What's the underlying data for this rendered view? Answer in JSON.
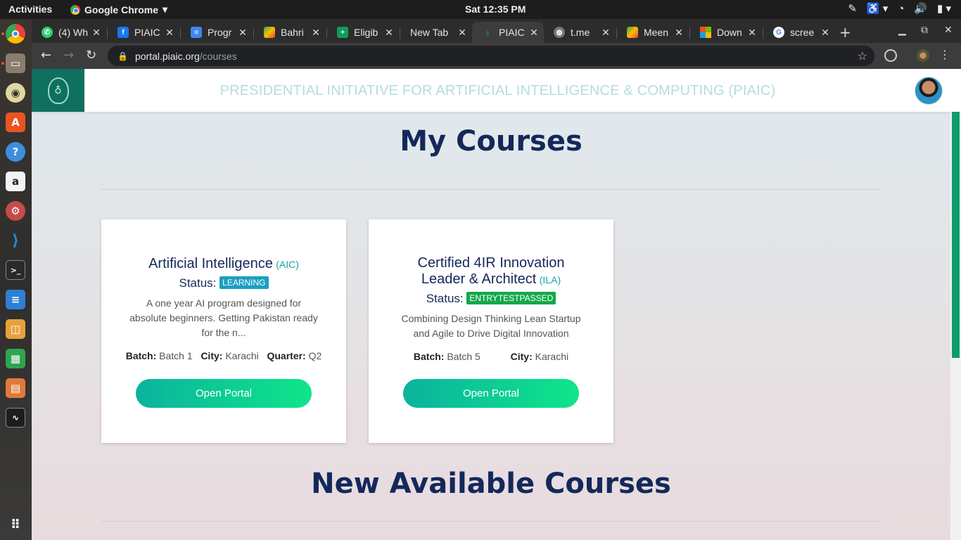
{
  "system": {
    "activities": "Activities",
    "app_name": "Google Chrome",
    "clock": "Sat 12:35 PM"
  },
  "tabs": [
    {
      "title": "(4) Wh",
      "icon": "whatsapp-icon",
      "color": "#25d366"
    },
    {
      "title": "PIAIC",
      "icon": "facebook-icon",
      "color": "#1877f2"
    },
    {
      "title": "Progr",
      "icon": "docs-icon",
      "color": "#4285f4"
    },
    {
      "title": "Bahri",
      "icon": "maps-icon",
      "color": "#34a853"
    },
    {
      "title": "Eligib",
      "icon": "sheets-icon",
      "color": "#0f9d58"
    },
    {
      "title": "New Tab",
      "icon": "",
      "color": ""
    },
    {
      "title": "PIAIC",
      "icon": "piaic-icon",
      "color": "#0f7060",
      "active": true
    },
    {
      "title": "t.me",
      "icon": "globe-icon",
      "color": "#777"
    },
    {
      "title": "Meen",
      "icon": "maps-icon",
      "color": "#34a853"
    },
    {
      "title": "Down",
      "icon": "microsoft-icon",
      "color": "#f25022"
    },
    {
      "title": "scree",
      "icon": "google-icon",
      "color": "#4285f4"
    }
  ],
  "address": {
    "host": "portal.piaic.org",
    "path": "/courses"
  },
  "site": {
    "title": "PRESIDENTIAL INITIATIVE FOR ARTIFICIAL INTELLIGENCE & COMPUTING (PIAIC)"
  },
  "page": {
    "my_courses": "My Courses",
    "new_courses": "New Available Courses"
  },
  "courses": [
    {
      "title": "Artificial Intelligence",
      "code": "(AIC)",
      "status_label": "Status:",
      "status": "LEARNING",
      "description": "A one year AI program designed for absolute beginners. Getting Pakistan ready for the n...",
      "batch_label": "Batch:",
      "batch": "Batch 1",
      "city_label": "City:",
      "city": "Karachi",
      "quarter_label": "Quarter:",
      "quarter": "Q2",
      "button": "Open Portal"
    },
    {
      "title_line1": "Certified 4IR Innovation",
      "title_line2": "Leader & Architect",
      "code": "(ILA)",
      "status_label": "Status:",
      "status": "ENTRYTESTPASSED",
      "description": "Combining Design Thinking Lean Startup and Agile to Drive Digital Innovation",
      "batch_label": "Batch:",
      "batch": "Batch 5",
      "city_label": "City:",
      "city": "Karachi",
      "button": "Open Portal"
    }
  ],
  "dock": [
    "chrome-icon",
    "files-icon",
    "rhythmbox-icon",
    "software-icon",
    "help-icon",
    "amazon-icon",
    "settings-icon",
    "vscode-icon",
    "terminal-icon",
    "writer-icon",
    "impress-icon",
    "calc-icon",
    "presentation-icon",
    "system-monitor-icon",
    "app-grid-icon"
  ]
}
